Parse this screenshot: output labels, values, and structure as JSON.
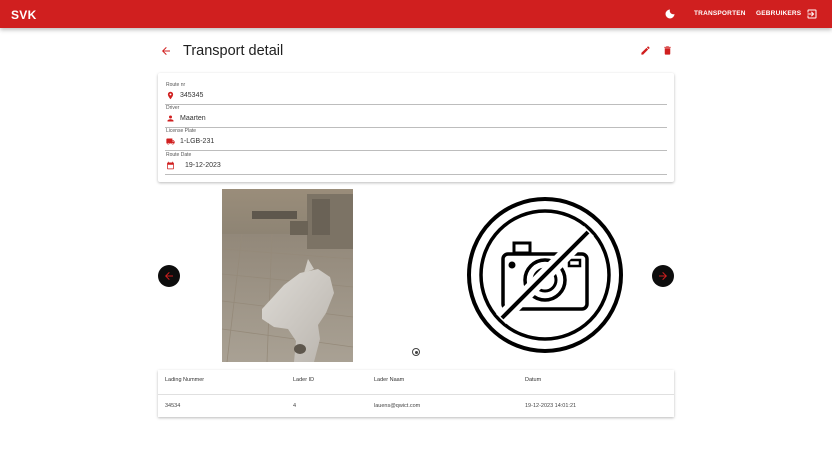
{
  "app": {
    "brand": "SVK"
  },
  "nav": {
    "transporten": "TRANSPORTEN",
    "gebruikers": "GEBRUIKERS"
  },
  "page": {
    "title": "Transport detail"
  },
  "fields": [
    {
      "label": "Route nr",
      "value": "345345",
      "icon": "location-pin-icon"
    },
    {
      "label": "Driver",
      "value": "Maarten",
      "icon": "person-icon"
    },
    {
      "label": "License Plate",
      "value": "1-LGB-231",
      "icon": "truck-icon"
    },
    {
      "label": "Route Date",
      "value": "19-12-2023",
      "icon": "calendar-icon"
    }
  ],
  "carousel": {
    "slide_count": 1,
    "active_index": 0
  },
  "table": {
    "headers": [
      "Lading Nummer",
      "Lader ID",
      "Lader Naam",
      "Datum"
    ],
    "rows": [
      [
        "34534",
        "4",
        "lauens@qwict.com",
        "19-12-2023 14:01:21"
      ]
    ]
  },
  "colors": {
    "accent": "#d01f1f",
    "navbar_text": "#ffffff",
    "button_dark": "#0d0d0d"
  }
}
